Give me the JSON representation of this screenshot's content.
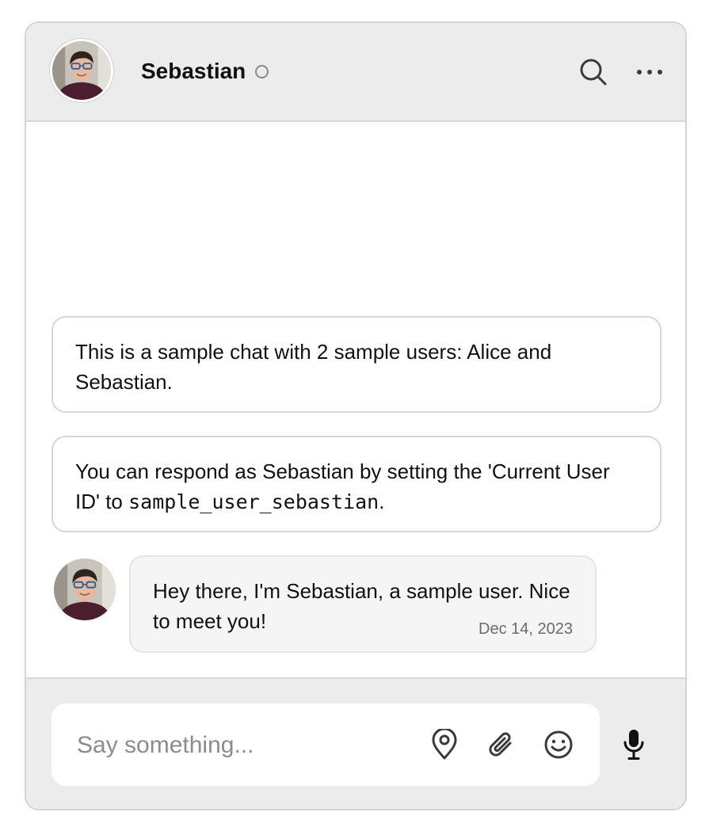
{
  "header": {
    "user_name": "Sebastian",
    "status": "offline",
    "icons": [
      "avatar",
      "status-dot-icon",
      "search-icon",
      "more-icon"
    ]
  },
  "messages": {
    "system": [
      {
        "text": "This is a sample chat with 2 sample users: Alice and Sebastian."
      },
      {
        "prefix": "You can respond as Sebastian by setting the 'Current User ID' to ",
        "code": "sample_user_sebastian",
        "suffix": "."
      }
    ],
    "user_message": {
      "sender": "Sebastian",
      "text": "Hey there, I'm Sebastian, a sample user. Nice to meet you!",
      "date": "Dec 14, 2023"
    }
  },
  "composer": {
    "placeholder": "Say something...",
    "icons": [
      "location-pin-icon",
      "paperclip-icon",
      "emoji-icon",
      "microphone-icon"
    ]
  },
  "colors": {
    "header_bg": "#ececec",
    "bubble_bg": "#f5f5f5",
    "border": "#d6d6d6",
    "text": "#111111",
    "muted": "#8c8c8c"
  }
}
